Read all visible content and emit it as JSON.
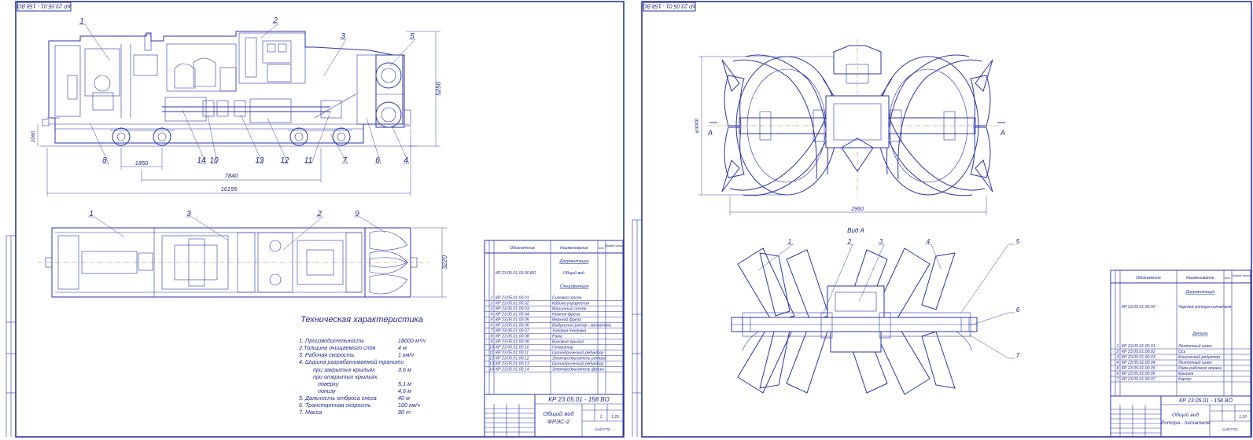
{
  "left_sheet": {
    "corner_stamp": "КР 23.05.01 - 158 ВО",
    "main_view": {
      "callouts": [
        "1",
        "2",
        "3",
        "5",
        "8",
        "14",
        "10",
        "13",
        "12",
        "11",
        "7",
        "6",
        "4"
      ],
      "dims": {
        "height": "5250",
        "rail": "1060",
        "bogie": "1850",
        "base": "7840",
        "length": "16195"
      }
    },
    "plan_view": {
      "callouts": [
        "1",
        "3",
        "2",
        "9"
      ],
      "dims": {
        "width": "3220"
      }
    },
    "tech": {
      "title": "Техническая характеристика",
      "rows": [
        {
          "label": "1. Производительность",
          "value": "18000 м³/ч"
        },
        {
          "label": "2.Толщина очищаемого слоя",
          "value": "4 м"
        },
        {
          "label": "3. Рабочая скорость",
          "value": "1 км/ч"
        },
        {
          "label": "4. Ширина разрабатываемой траншеи",
          "value": ""
        },
        {
          "label": "при закрытых крыльях",
          "value": "3,6 м"
        },
        {
          "label": "при открытых крыльях",
          "value": ""
        },
        {
          "label": "поверху",
          "value": "5,1 м"
        },
        {
          "label": "понизу",
          "value": "4,6 м"
        },
        {
          "label": "5. Дальность отброса снега",
          "value": "40 м"
        },
        {
          "label": "6. Транспортная скорость",
          "value": "100 км/ч"
        },
        {
          "label": "7. Масса",
          "value": "80 т"
        }
      ]
    },
    "spec": {
      "headers": [
        "Обозначение",
        "Наименование",
        "Кол.",
        "Приме-чание"
      ],
      "section_docs": "Документация",
      "doc_row": {
        "pos": "",
        "code": "КР 23.05.01.00.00 ВО",
        "name": "Общий вид"
      },
      "section_units": "Спецификация",
      "rows": [
        {
          "pos": "1",
          "code": "КР 23.05.01.00.01",
          "name": "Силовой отсек"
        },
        {
          "pos": "2",
          "code": "КР 23.05.01.00.02",
          "name": "Кабина управления"
        },
        {
          "pos": "3",
          "code": "КР 23.05.01.00.03",
          "name": "Машинный отсек"
        },
        {
          "pos": "4",
          "code": "КР 23.05.01.00.04",
          "name": "Нижняя фреза"
        },
        {
          "pos": "5",
          "code": "КР 23.05.01.00.05",
          "name": "Верхняя фреза"
        },
        {
          "pos": "6",
          "code": "КР 23.05.01.00.06",
          "name": "Выбросной ротор - метатель"
        },
        {
          "pos": "7",
          "code": "КР 23.05.01.00.07",
          "name": "Ходовая тележка"
        },
        {
          "pos": "8",
          "code": "КР 23.05.01.00.08",
          "name": "Рама"
        },
        {
          "pos": "9",
          "code": "КР 23.05.01.00.09",
          "name": "Боковые крылья"
        },
        {
          "pos": "10",
          "code": "КР 23.05.01.00.10",
          "name": "Генератор"
        },
        {
          "pos": "11",
          "code": "КР 23.05.01.00.11",
          "name": "Цилиндрический редуктор"
        },
        {
          "pos": "12",
          "code": "КР 23.05.01.00.12",
          "name": "Электродвигатель ротора"
        },
        {
          "pos": "13",
          "code": "КР 23.05.01.00.13",
          "name": "Цилиндрический редуктор"
        },
        {
          "pos": "14",
          "code": "КР 23.05.01.00.14",
          "name": "Электродвигатель фрезы"
        }
      ]
    },
    "title_block": {
      "code": "КР 23.05.01 - 158 ВО",
      "name_line1": "Общий вид",
      "name_line2": "ФРЭС-2",
      "sheet": "1",
      "scale": "1:25",
      "org": "СибГУПС"
    }
  },
  "right_sheet": {
    "corner_stamp": "КР 23.05.01 - 158 ВО",
    "top_view": {
      "section_marks": [
        "А",
        "А"
      ],
      "dims": {
        "diameter": "ø3000",
        "width": "2960"
      }
    },
    "view_a": {
      "title": "Вид А",
      "callouts": [
        "1",
        "2",
        "3",
        "4",
        "5",
        "6",
        "7"
      ]
    },
    "spec": {
      "headers": [
        "Обозначение",
        "Наименование",
        "Кол.",
        "Приме-чание"
      ],
      "section_docs": "Документация",
      "doc_row": {
        "pos": "",
        "code": "КР 23.05.01.00.00",
        "name": "Чертеж ротора-питателя"
      },
      "section_parts": "Детали",
      "rows": [
        {
          "pos": "1",
          "code": "КР 23.05.01.00.01",
          "name": "Ленточный шнек"
        },
        {
          "pos": "2",
          "code": "КР 23.05.01.00.02",
          "name": "Ось"
        },
        {
          "pos": "3",
          "code": "КР 23.05.01.00.03",
          "name": "Конический редуктор"
        },
        {
          "pos": "4",
          "code": "КР 23.05.01.00.04",
          "name": "Ленточный шнек"
        },
        {
          "pos": "5",
          "code": "КР 23.05.01.00.05",
          "name": "Рама рабочего органа"
        },
        {
          "pos": "6",
          "code": "КР 23.05.01.00.06",
          "name": "Крышка"
        },
        {
          "pos": "7",
          "code": "КР 23.05.01.00.07",
          "name": "Корпус"
        }
      ]
    },
    "title_block": {
      "code": "КР 23.05.01 - 158 ВО",
      "name_line1": "Общий вид",
      "name_line2": "Ротора - питателя",
      "scale": "1:10",
      "org": "СибГУПС"
    }
  }
}
